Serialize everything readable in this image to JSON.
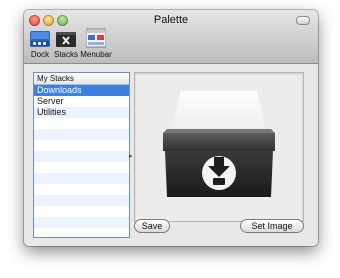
{
  "window": {
    "title": "Palette"
  },
  "toolbar": {
    "items": [
      {
        "label": "Dock",
        "icon": "dock-icon",
        "selected": true
      },
      {
        "label": "Stacks",
        "icon": "stacks-icon",
        "selected": false
      },
      {
        "label": "Menubar",
        "icon": "menubar-icon",
        "selected": false
      }
    ]
  },
  "sidebar": {
    "header": "My Stacks",
    "items": [
      {
        "label": "Downloads",
        "selected": true
      },
      {
        "label": "Server",
        "selected": false
      },
      {
        "label": "Utilities",
        "selected": false
      }
    ]
  },
  "preview": {
    "icon": "downloads-stack-box-icon"
  },
  "buttons": {
    "save": "Save",
    "set_image": "Set Image"
  },
  "colors": {
    "selection": "#3d80df",
    "alt_row": "#edf3fe",
    "accent_border": "#6e8fb8"
  }
}
